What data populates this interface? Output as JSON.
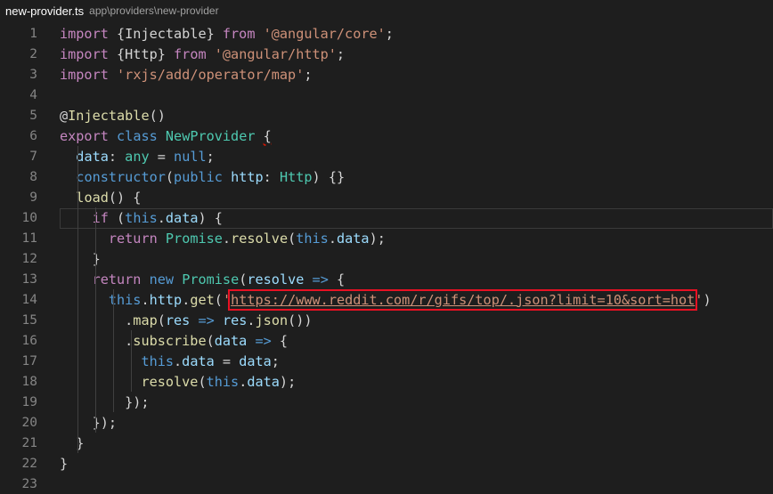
{
  "header": {
    "file_name": "new-provider.ts",
    "file_path": "app\\providers\\new-provider"
  },
  "lines": [
    {
      "n": "1",
      "tokens": [
        [
          "cf",
          "import"
        ],
        [
          "txt",
          " {Injectable} "
        ],
        [
          "cf",
          "from"
        ],
        [
          "txt",
          " "
        ],
        [
          "str",
          "'@angular/core'"
        ],
        [
          "txt",
          ";"
        ]
      ]
    },
    {
      "n": "2",
      "tokens": [
        [
          "cf",
          "import"
        ],
        [
          "txt",
          " {Http} "
        ],
        [
          "cf",
          "from"
        ],
        [
          "txt",
          " "
        ],
        [
          "str",
          "'@angular/http'"
        ],
        [
          "txt",
          ";"
        ]
      ]
    },
    {
      "n": "3",
      "tokens": [
        [
          "cf",
          "import"
        ],
        [
          "txt",
          " "
        ],
        [
          "str",
          "'rxjs/add/operator/map'"
        ],
        [
          "txt",
          ";"
        ]
      ]
    },
    {
      "n": "4",
      "tokens": []
    },
    {
      "n": "5",
      "tokens": [
        [
          "txt",
          "@"
        ],
        [
          "fn",
          "Injectable"
        ],
        [
          "txt",
          "()"
        ]
      ]
    },
    {
      "n": "6",
      "tokens": [
        [
          "cf",
          "export"
        ],
        [
          "txt",
          " "
        ],
        [
          "kw",
          "class"
        ],
        [
          "txt",
          " "
        ],
        [
          "cls",
          "NewProvider"
        ],
        [
          "txt",
          " "
        ],
        [
          "sq",
          "{"
        ]
      ]
    },
    {
      "n": "7",
      "tokens": [
        [
          "txt",
          "  "
        ],
        [
          "var",
          "data"
        ],
        [
          "txt",
          ": "
        ],
        [
          "cls",
          "any"
        ],
        [
          "txt",
          " = "
        ],
        [
          "kw",
          "null"
        ],
        [
          "txt",
          ";"
        ]
      ]
    },
    {
      "n": "8",
      "tokens": [
        [
          "txt",
          "  "
        ],
        [
          "kw",
          "constructor"
        ],
        [
          "txt",
          "("
        ],
        [
          "kw",
          "public"
        ],
        [
          "txt",
          " "
        ],
        [
          "var",
          "http"
        ],
        [
          "txt",
          ": "
        ],
        [
          "cls",
          "Http"
        ],
        [
          "txt",
          ") {}"
        ]
      ]
    },
    {
      "n": "9",
      "tokens": [
        [
          "txt",
          "  "
        ],
        [
          "fn",
          "load"
        ],
        [
          "txt",
          "() {"
        ]
      ]
    },
    {
      "n": "10",
      "tokens": [
        [
          "txt",
          "    "
        ],
        [
          "cf",
          "if"
        ],
        [
          "txt",
          " ("
        ],
        [
          "kw",
          "this"
        ],
        [
          "txt",
          "."
        ],
        [
          "var",
          "data"
        ],
        [
          "txt",
          ") "
        ],
        [
          "txt",
          "{"
        ]
      ]
    },
    {
      "n": "11",
      "tokens": [
        [
          "txt",
          "      "
        ],
        [
          "cf",
          "return"
        ],
        [
          "txt",
          " "
        ],
        [
          "cls",
          "Promise"
        ],
        [
          "txt",
          "."
        ],
        [
          "fn",
          "resolve"
        ],
        [
          "txt",
          "("
        ],
        [
          "kw",
          "this"
        ],
        [
          "txt",
          "."
        ],
        [
          "var",
          "data"
        ],
        [
          "txt",
          ");"
        ]
      ]
    },
    {
      "n": "12",
      "tokens": [
        [
          "txt",
          "    "
        ],
        [
          "txt",
          "}"
        ]
      ]
    },
    {
      "n": "13",
      "tokens": [
        [
          "txt",
          "    "
        ],
        [
          "cf",
          "return"
        ],
        [
          "txt",
          " "
        ],
        [
          "kw",
          "new"
        ],
        [
          "txt",
          " "
        ],
        [
          "cls",
          "Promise"
        ],
        [
          "txt",
          "("
        ],
        [
          "var",
          "resolve"
        ],
        [
          "txt",
          " "
        ],
        [
          "kw",
          "=>"
        ],
        [
          "txt",
          " {"
        ]
      ]
    },
    {
      "n": "14",
      "tokens": [
        [
          "txt",
          "      "
        ],
        [
          "kw",
          "this"
        ],
        [
          "txt",
          "."
        ],
        [
          "var",
          "http"
        ],
        [
          "txt",
          "."
        ],
        [
          "fn",
          "get"
        ],
        [
          "txt",
          "("
        ],
        [
          "str",
          "'"
        ],
        [
          "url",
          "https://www.reddit.com/r/gifs/top/.json?limit=10&sort=hot"
        ],
        [
          "str",
          "'"
        ],
        [
          "txt",
          ")"
        ]
      ]
    },
    {
      "n": "15",
      "tokens": [
        [
          "txt",
          "        ."
        ],
        [
          "fn",
          "map"
        ],
        [
          "txt",
          "("
        ],
        [
          "var",
          "res"
        ],
        [
          "txt",
          " "
        ],
        [
          "kw",
          "=>"
        ],
        [
          "txt",
          " "
        ],
        [
          "var",
          "res"
        ],
        [
          "txt",
          "."
        ],
        [
          "fn",
          "json"
        ],
        [
          "txt",
          "())"
        ]
      ]
    },
    {
      "n": "16",
      "tokens": [
        [
          "txt",
          "        ."
        ],
        [
          "fn",
          "subscribe"
        ],
        [
          "txt",
          "("
        ],
        [
          "var",
          "data"
        ],
        [
          "txt",
          " "
        ],
        [
          "kw",
          "=>"
        ],
        [
          "txt",
          " {"
        ]
      ]
    },
    {
      "n": "17",
      "tokens": [
        [
          "txt",
          "          "
        ],
        [
          "kw",
          "this"
        ],
        [
          "txt",
          "."
        ],
        [
          "var",
          "data"
        ],
        [
          "txt",
          " = "
        ],
        [
          "var",
          "data"
        ],
        [
          "txt",
          ";"
        ]
      ]
    },
    {
      "n": "18",
      "tokens": [
        [
          "txt",
          "          "
        ],
        [
          "fn",
          "resolve"
        ],
        [
          "txt",
          "("
        ],
        [
          "kw",
          "this"
        ],
        [
          "txt",
          "."
        ],
        [
          "var",
          "data"
        ],
        [
          "txt",
          ");"
        ]
      ]
    },
    {
      "n": "19",
      "tokens": [
        [
          "txt",
          "        });"
        ]
      ]
    },
    {
      "n": "20",
      "tokens": [
        [
          "txt",
          "    });"
        ]
      ]
    },
    {
      "n": "21",
      "tokens": [
        [
          "txt",
          "  }"
        ]
      ]
    },
    {
      "n": "22",
      "tokens": [
        [
          "txt",
          "}"
        ]
      ]
    },
    {
      "n": "23",
      "tokens": []
    }
  ],
  "colors": {
    "background": "#1e1e1e",
    "keyword": "#569cd6",
    "control": "#c586c0",
    "string": "#ce9178",
    "variable": "#9cdcfe",
    "function": "#dcdcaa",
    "type": "#4ec9b0",
    "highlight_box": "#e81123"
  }
}
